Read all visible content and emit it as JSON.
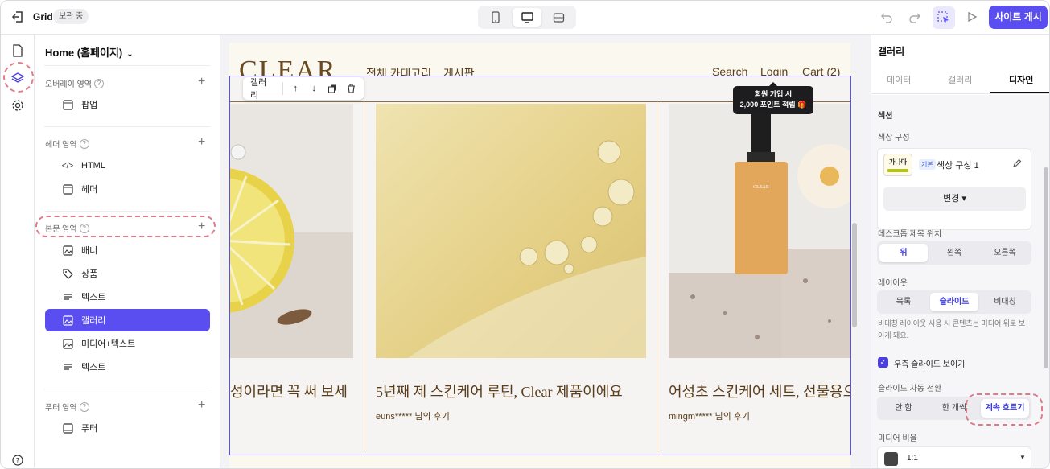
{
  "topbar": {
    "title": "Grid",
    "badge": "보관 중",
    "publish_label": "사이트 게시"
  },
  "layers": {
    "page_select": "Home (홈페이지)",
    "sections": [
      {
        "label": "오버레이 영역",
        "items": [
          {
            "label": "팝업",
            "icon": "popup-icon"
          }
        ]
      },
      {
        "label": "헤더 영역",
        "items": [
          {
            "label": "HTML",
            "icon": "code-icon"
          },
          {
            "label": "헤더",
            "icon": "header-icon"
          }
        ]
      },
      {
        "label": "본문 영역",
        "items": [
          {
            "label": "배너",
            "icon": "image-icon"
          },
          {
            "label": "상품",
            "icon": "tag-icon"
          },
          {
            "label": "텍스트",
            "icon": "text-icon"
          },
          {
            "label": "갤러리",
            "icon": "gallery-icon"
          },
          {
            "label": "미디어+텍스트",
            "icon": "image-icon"
          },
          {
            "label": "텍스트",
            "icon": "text-icon"
          }
        ]
      },
      {
        "label": "푸터 영역",
        "items": [
          {
            "label": "푸터",
            "icon": "footer-icon"
          }
        ]
      }
    ]
  },
  "site": {
    "logo": "CLEAR",
    "nav_left": [
      "전체 카테고리",
      "게시판"
    ],
    "nav_right": [
      "Search",
      "Login",
      "Cart (2)"
    ],
    "tooltip_line1": "회원 가입 시",
    "tooltip_line2": "2,000 포인트 적립 🎁",
    "toolbar_label": "갤러리",
    "cards": [
      {
        "title": "성이라면 꼭 써 보세",
        "review": ""
      },
      {
        "title": "5년째 제 스킨케어 루틴, Clear 제품이에요",
        "review": "euns***** 님의 후기"
      },
      {
        "title": "어성초 스킨케어 세트, 선물용으",
        "review": "mingm***** 님의 후기"
      }
    ],
    "bottle_brand": "CLEAR"
  },
  "panel": {
    "title": "갤러리",
    "tabs": [
      "데이터",
      "갤러리",
      "디자인"
    ],
    "active_tab": "디자인",
    "section_label": "섹션",
    "color_label": "색상 구성",
    "swatch_text": "가나다",
    "basic_tag": "기본",
    "color_name": "색상 구성 1",
    "change_label": "변경 ▾",
    "title_pos_label": "데스크톱 제목 위치",
    "title_pos_opts": [
      "위",
      "왼쪽",
      "오른쪽"
    ],
    "layout_label": "레이아웃",
    "layout_opts": [
      "목록",
      "슬라이드",
      "비대칭"
    ],
    "note": "비대칭 레이아웃 사용 시 콘텐츠는 미디어 위로 보이게 돼요.",
    "show_right_label": "우측 슬라이드 보이기",
    "auto_label": "슬라이드 자동 전환",
    "auto_opts": [
      "안 함",
      "한 개씩",
      "계속 흐르기"
    ],
    "ratio_label": "미디어 비율",
    "ratio_value": "1:1"
  },
  "colors": {
    "accent": "#5b4ef0",
    "highlight_ring": "#e07a8a",
    "brand_brown": "#6b4a22"
  }
}
